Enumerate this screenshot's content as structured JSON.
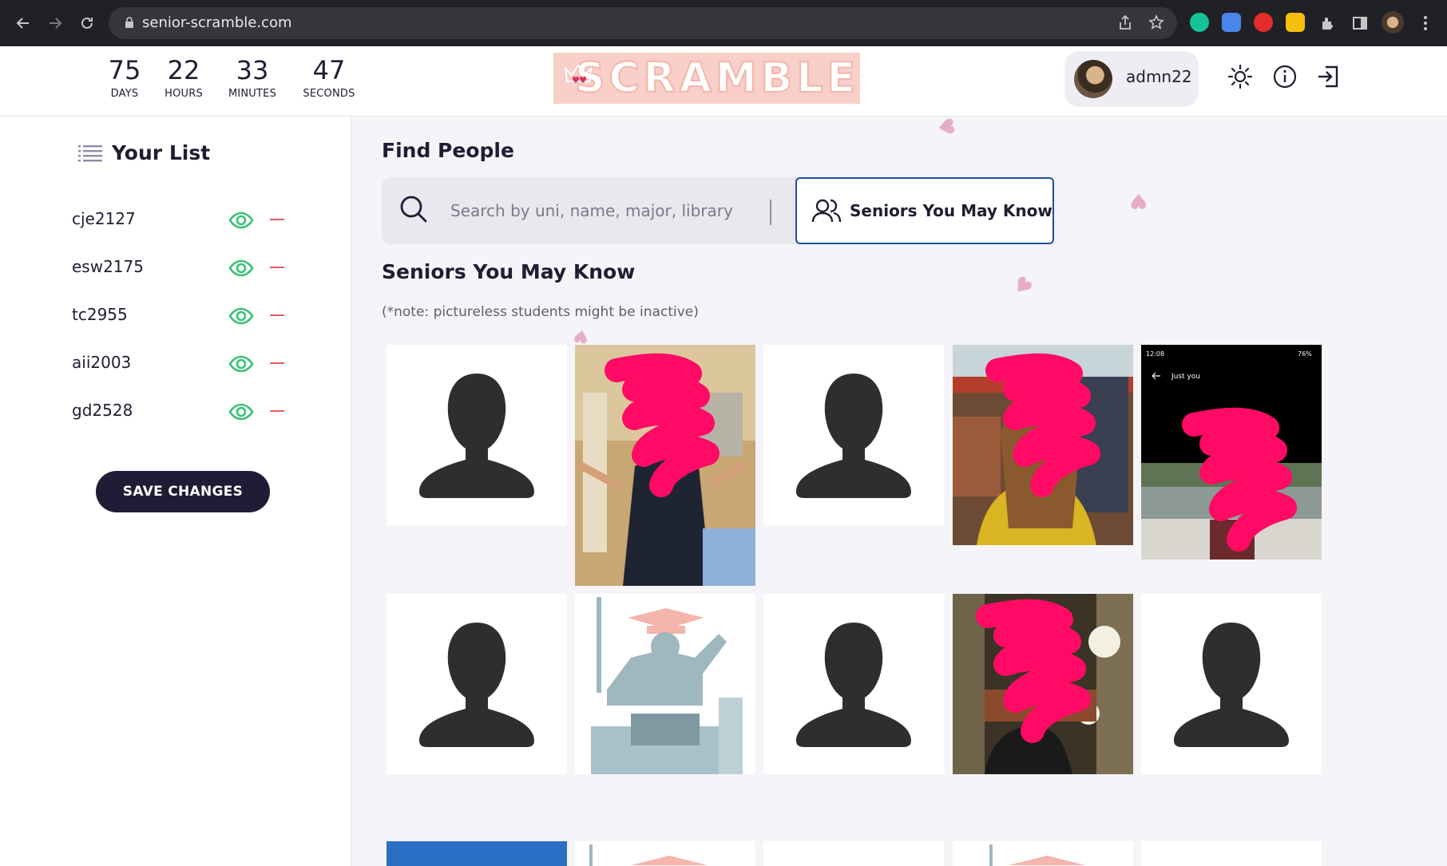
{
  "browser": {
    "url": "senior-scramble.com",
    "icons": [
      "back-icon",
      "forward-icon",
      "reload-icon",
      "lock-icon",
      "share-icon",
      "star-icon",
      "grammarly-icon",
      "translate-icon",
      "adblock-icon",
      "keep-icon",
      "extensions-icon",
      "sidepanel-icon",
      "profile-icon",
      "menu-icon"
    ]
  },
  "countdown": [
    {
      "value": "75",
      "unit": "DAYS"
    },
    {
      "value": "22",
      "unit": "HOURS"
    },
    {
      "value": "33",
      "unit": "MINUTES"
    },
    {
      "value": "47",
      "unit": "SECONDS"
    }
  ],
  "logo": {
    "text": "SCRAMBLE",
    "bg": "#f8cfc9"
  },
  "user": {
    "name": "admn22"
  },
  "header_icons": [
    "theme-sun-icon",
    "info-icon",
    "logout-icon"
  ],
  "sidebar": {
    "title": "Your List",
    "items": [
      {
        "uni": "cje2127"
      },
      {
        "uni": "esw2175"
      },
      {
        "uni": "tc2955"
      },
      {
        "uni": "aii2003"
      },
      {
        "uni": "gd2528"
      }
    ],
    "save_label": "SAVE CHANGES"
  },
  "main": {
    "find_title": "Find People",
    "search_placeholder": "Search by uni, name, major, library",
    "smk_button": "Seniors You May Know",
    "smk_title": "Seniors You May Know",
    "note": "(*note: pictureless students might be inactive)",
    "phone_status_time": "12:08",
    "phone_status_battery": "76%",
    "phone_header": "Just you"
  },
  "colors": {
    "accent_dark": "#201c36",
    "eye_green": "#3cc07a",
    "remove_red": "#e55a5a",
    "focus_blue": "#1c4fa8",
    "scribble_pink": "#ff0a64"
  }
}
